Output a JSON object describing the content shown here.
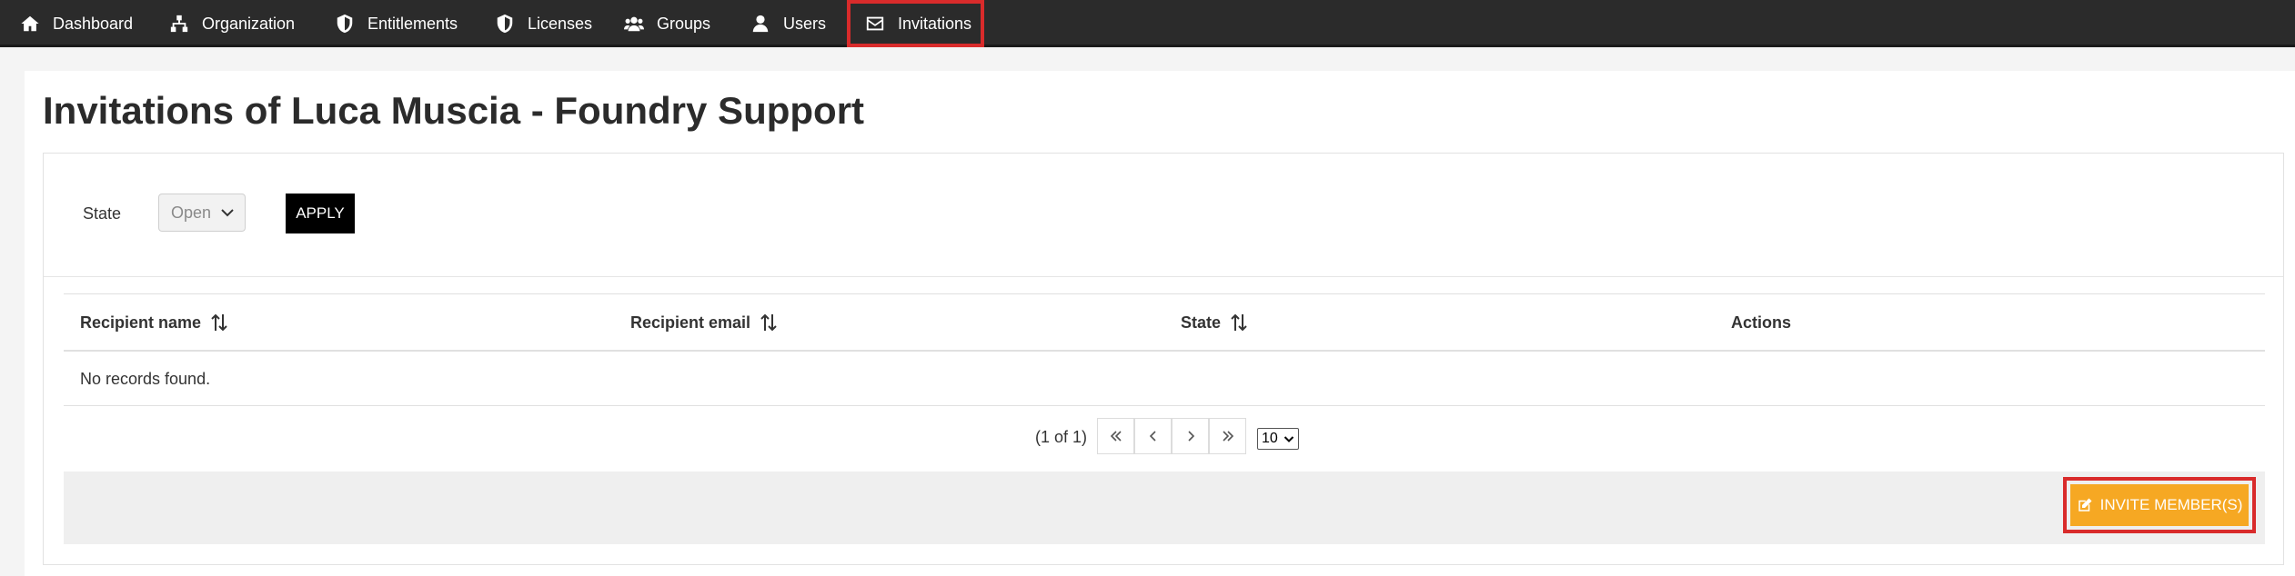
{
  "nav": {
    "items": [
      {
        "label": "Dashboard",
        "icon": "home-icon"
      },
      {
        "label": "Organization",
        "icon": "sitemap-icon"
      },
      {
        "label": "Entitlements",
        "icon": "shield-icon"
      },
      {
        "label": "Licenses",
        "icon": "shield-icon"
      },
      {
        "label": "Groups",
        "icon": "users-icon"
      },
      {
        "label": "Users",
        "icon": "user-icon"
      },
      {
        "label": "Invitations",
        "icon": "envelope-icon"
      }
    ],
    "active": "Invitations",
    "background": "#2b2b2b"
  },
  "page": {
    "title": "Invitations of Luca Muscia - Foundry Support"
  },
  "filter": {
    "state_label": "State",
    "state_value": "Open",
    "apply_label": "APPLY"
  },
  "table": {
    "columns": [
      {
        "label": "Recipient name",
        "sortable": true
      },
      {
        "label": "Recipient email",
        "sortable": true
      },
      {
        "label": "State",
        "sortable": true
      },
      {
        "label": "Actions",
        "sortable": false
      }
    ],
    "empty_message": "No records found."
  },
  "paginator": {
    "report": "(1 of 1)",
    "rows_per_page": "10"
  },
  "actions": {
    "invite_label": "INVITE MEMBER(S)",
    "invite_color": "#f6a823",
    "highlight_color": "#d92b2b"
  }
}
